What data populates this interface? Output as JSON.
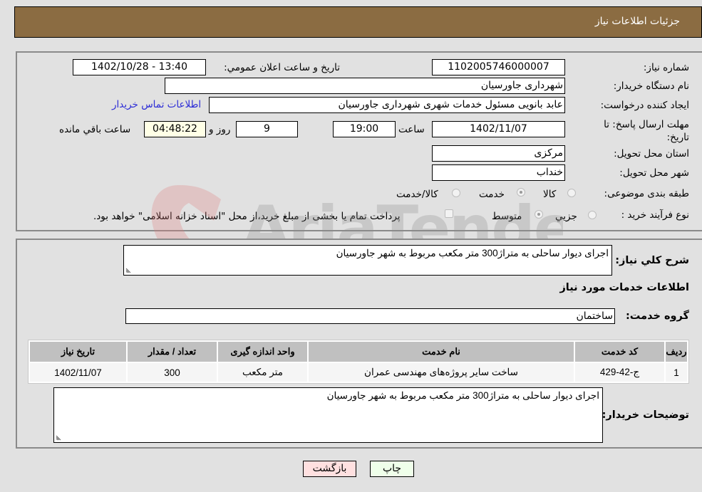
{
  "header": {
    "title": "جزئیات اطلاعات نیاز"
  },
  "form": {
    "need_number": {
      "label": "شماره نیاز:",
      "value": "1102005746000007"
    },
    "announce_datetime": {
      "label": "تاریخ و ساعت اعلان عمومي:",
      "value": "1402/10/28 - 13:40"
    },
    "buyer_org": {
      "label": "نام دستگاه خريدار:",
      "value": "شهرداری جاورسیان"
    },
    "requester": {
      "label": "ایجاد کننده درخواست:",
      "value": "عابد بانویی مسئول خدمات شهری شهرداری جاورسیان"
    },
    "contact_link": "اطلاعات تماس خريدار",
    "deadline": {
      "label": "مهلت ارسال پاسخ: تا تاریخ:",
      "date": "1402/11/07",
      "time_label": "ساعت",
      "time": "19:00",
      "days": "9",
      "days_label": "روز و",
      "remaining": "04:48:22",
      "remaining_label": "ساعت باقي مانده"
    },
    "province": {
      "label": "استان محل تحویل:",
      "value": "مرکزی"
    },
    "city": {
      "label": "شهر محل تحویل:",
      "value": "خنداب"
    },
    "category": {
      "label": "طبقه بندی موضوعی:",
      "options": [
        "کالا",
        "خدمت",
        "کالا/خدمت"
      ],
      "selected": "خدمت"
    },
    "purchase_type": {
      "label": "نوع فرآیند خرید :",
      "options": [
        "جزيي",
        "متوسط"
      ],
      "selected": "متوسط",
      "treasury_note": "پرداخت تمام یا بخشی از مبلغ خرید،از محل \"اسناد خزانه اسلامی\" خواهد بود."
    }
  },
  "details": {
    "summary_label": "شرح كلي نياز:",
    "summary_value": "اجرای دیوار ساحلی به متراژ300 متر مکعب مربوط به شهر جاورسیان",
    "services_title": "اطلاعات خدمات مورد نیاز",
    "service_group_label": "گروه خدمت:",
    "service_group_value": "ساختمان",
    "table": {
      "headers": [
        "ردیف",
        "کد خدمت",
        "نام خدمت",
        "واحد اندازه گیری",
        "تعداد / مقدار",
        "تاریخ نیاز"
      ],
      "rows": [
        [
          "1",
          "ج-42-429",
          "ساخت سایر پروژه‌های مهندسی عمران",
          "متر مکعب",
          "300",
          "1402/11/07"
        ]
      ]
    },
    "buyer_notes_label": "توضیحات خریدار:",
    "buyer_notes_value": "اجرای دیوار ساحلی به متراژ300 متر مکعب مربوط به شهر جاورسیان"
  },
  "buttons": {
    "print": "چاپ",
    "back": "بازگشت"
  },
  "colors": {
    "header_bg": "#8b6c42",
    "print_bg": "#efffea",
    "back_bg": "#ffe0e0",
    "link": "#2b2bd6"
  }
}
